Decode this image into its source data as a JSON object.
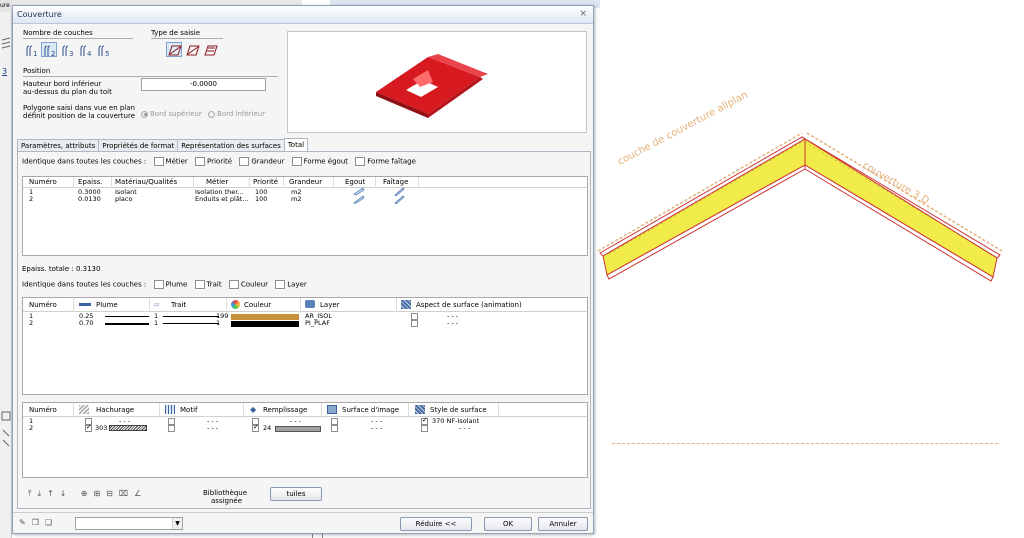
{
  "background": {
    "left_tab_label": "ure",
    "left_link": "3"
  },
  "dialog": {
    "title": "Couverture",
    "close_glyph": "×",
    "layers_count": {
      "label": "Nombre de couches",
      "options": [
        "1",
        "2",
        "3",
        "4",
        "5"
      ],
      "selected_index": 1
    },
    "input_type": {
      "label": "Type de saisie"
    },
    "position": {
      "label": "Position",
      "height_label_1": "Hauteur bord inférieur",
      "height_label_2": "au-dessus du plan du toit",
      "height_value": "-0.0000",
      "polygon_label_1": "Polygone saisi dans vue en plan",
      "polygon_label_2": "définit position de la couverture",
      "radio_top": "Bord supérieur",
      "radio_bottom": "Bord inférieur"
    },
    "tabs": [
      {
        "label": "Paramètres, attributs"
      },
      {
        "label": "Propriétés de format"
      },
      {
        "label": "Représentation des surfaces"
      },
      {
        "label": "Total"
      }
    ],
    "active_tab_index": 3,
    "identical1": {
      "label": "Identique dans toutes les couches :",
      "options": [
        "Métier",
        "Priorité",
        "Grandeur",
        "Forme égout",
        "Forme faîtage"
      ]
    },
    "table1": {
      "headers": [
        "Numéro",
        "Epaiss.",
        "Matériau/Qualités",
        "Métier",
        "Priorité",
        "Grandeur",
        "Egout",
        "Faîtage"
      ],
      "rows": [
        {
          "num": "1",
          "ep": "0.3000",
          "mat": "Isolant",
          "metier": "Isolation ther...",
          "prio": "100",
          "grand": "m2"
        },
        {
          "num": "2",
          "ep": "0.0130",
          "mat": "placo",
          "metier": "Enduits et plât...",
          "prio": "100",
          "grand": "m2"
        }
      ]
    },
    "total_thickness": "Epaiss. totale :  0.3130",
    "identical2": {
      "label": "Identique dans toutes les couches :",
      "options": [
        "Plume",
        "Trait",
        "Couleur",
        "Layer"
      ]
    },
    "table2": {
      "headers": [
        "Numéro",
        "Plume",
        "Trait",
        "Couleur",
        "Layer",
        "Aspect de surface (animation)"
      ],
      "rows": [
        {
          "num": "1",
          "plume": "0.25",
          "trait": "1",
          "couleur": "199",
          "couleur_hex": "#c8923a",
          "layer": "AR_ISOL",
          "aspect": "- - -"
        },
        {
          "num": "2",
          "plume": "0.70",
          "trait": "1",
          "couleur": "1",
          "couleur_hex": "#000000",
          "layer": "PI_PLAF",
          "aspect": "- - -"
        }
      ]
    },
    "table3": {
      "headers": [
        "Numéro",
        "Hachurage",
        "Motif",
        "Remplissage",
        "Surface d'image",
        "Style de surface"
      ],
      "rows": [
        {
          "num": "1",
          "hach": "- - -",
          "motif": "- - -",
          "rempl": "- - -",
          "surf": "- - -",
          "style": "370 NF-Isolant"
        },
        {
          "num": "2",
          "hach": "303",
          "motif": "- - -",
          "rempl": "24",
          "surf": "- - -",
          "style": "- - -"
        }
      ]
    },
    "library_label_1": "Bibliothèque",
    "library_label_2": "assignée",
    "library_button": "tuiles",
    "footer": {
      "reduce": "Réduire <<",
      "ok": "OK",
      "cancel": "Annuler"
    }
  },
  "drawing": {
    "label_left": "couche de couverture allplan",
    "label_right": "couverture 3 D"
  },
  "colors": {
    "roof_red": "#d71920",
    "insulation_yellow": "#f2ec4a",
    "hatch_orange": "#e3b07a"
  }
}
